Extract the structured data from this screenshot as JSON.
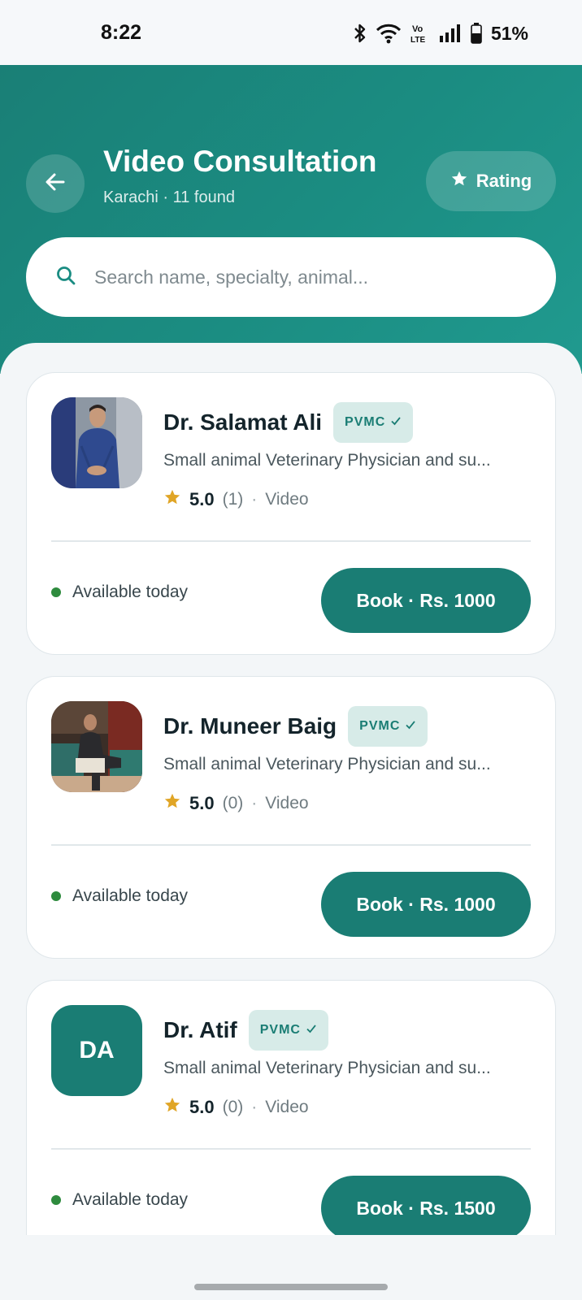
{
  "status_bar": {
    "time": "8:22",
    "battery": "51%",
    "icons": [
      "bluetooth-icon",
      "wifi-icon",
      "volte-icon",
      "signal-icon",
      "battery-icon"
    ]
  },
  "header": {
    "title": "Video Consultation",
    "subtitle": "Karachi · 11 found",
    "rating_button_label": "Rating",
    "search_placeholder": "Search name, specialty, animal..."
  },
  "doctors": [
    {
      "name": "Dr. Salamat Ali",
      "badge": "PVMC",
      "specialty": "Small animal Veterinary Physician and su...",
      "rating": "5.0",
      "reviews": "(1)",
      "mode": "Video",
      "availability": "Available today",
      "book_label": "Book · Rs. 1000",
      "avatar": "photo"
    },
    {
      "name": "Dr. Muneer Baig",
      "badge": "PVMC",
      "specialty": "Small animal Veterinary Physician and su...",
      "rating": "5.0",
      "reviews": "(0)",
      "mode": "Video",
      "availability": "Available today",
      "book_label": "Book · Rs. 1000",
      "avatar": "photo"
    },
    {
      "name": "Dr. Atif",
      "badge": "PVMC",
      "specialty": "Small animal Veterinary Physician and su...",
      "rating": "5.0",
      "reviews": "(0)",
      "mode": "Video",
      "availability": "Available today",
      "book_label": "Book · Rs. 1500",
      "avatar": "initials",
      "initials": "DA"
    }
  ],
  "colors": {
    "primary": "#1a7d74",
    "header_gradient_start": "#1a7f76",
    "header_gradient_end": "#209a8f",
    "badge_bg": "#d7ebe8",
    "star": "#e0a526",
    "available_dot": "#2e8b3e"
  }
}
